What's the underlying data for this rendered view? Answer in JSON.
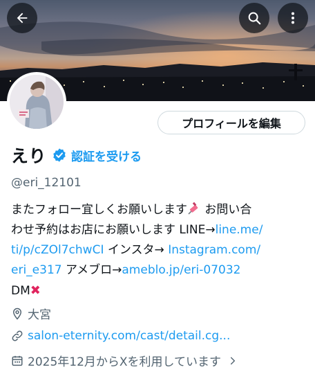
{
  "header": {
    "back_icon": "arrow-left-icon",
    "search_icon": "search-icon",
    "more_icon": "more-vertical-icon"
  },
  "profile": {
    "edit_button_label": "プロフィールを編集",
    "display_name": "えり",
    "verify_label": "認証を受ける",
    "handle": "@eri_12101"
  },
  "bio": {
    "l1_text": "またフォロー宜しくお願いします",
    "l1_after": " お問い合",
    "l2_text": "わせ予約はお店にお願いします LINE→",
    "l2_link": "line.me/",
    "l3_link": "ti/p/cZOl7chwCI",
    "l3_text": "  インスタ→ ",
    "l3_link2": "Instagram.com/",
    "l4_link": "eri_e317",
    "l4_text": " アメブロ→",
    "l4_link2": "ameblo.jp/eri-07032",
    "l5_text": "DM",
    "l5_emoji": "✖"
  },
  "meta": {
    "location": "大宮",
    "website": "salon-eternity.com/cast/detail.cg...",
    "joined": "2025年12月からXを利用しています"
  },
  "colors": {
    "accent": "#1d9bf0",
    "text": "#0f1419",
    "secondary": "#536471",
    "border": "#cfd9de"
  }
}
